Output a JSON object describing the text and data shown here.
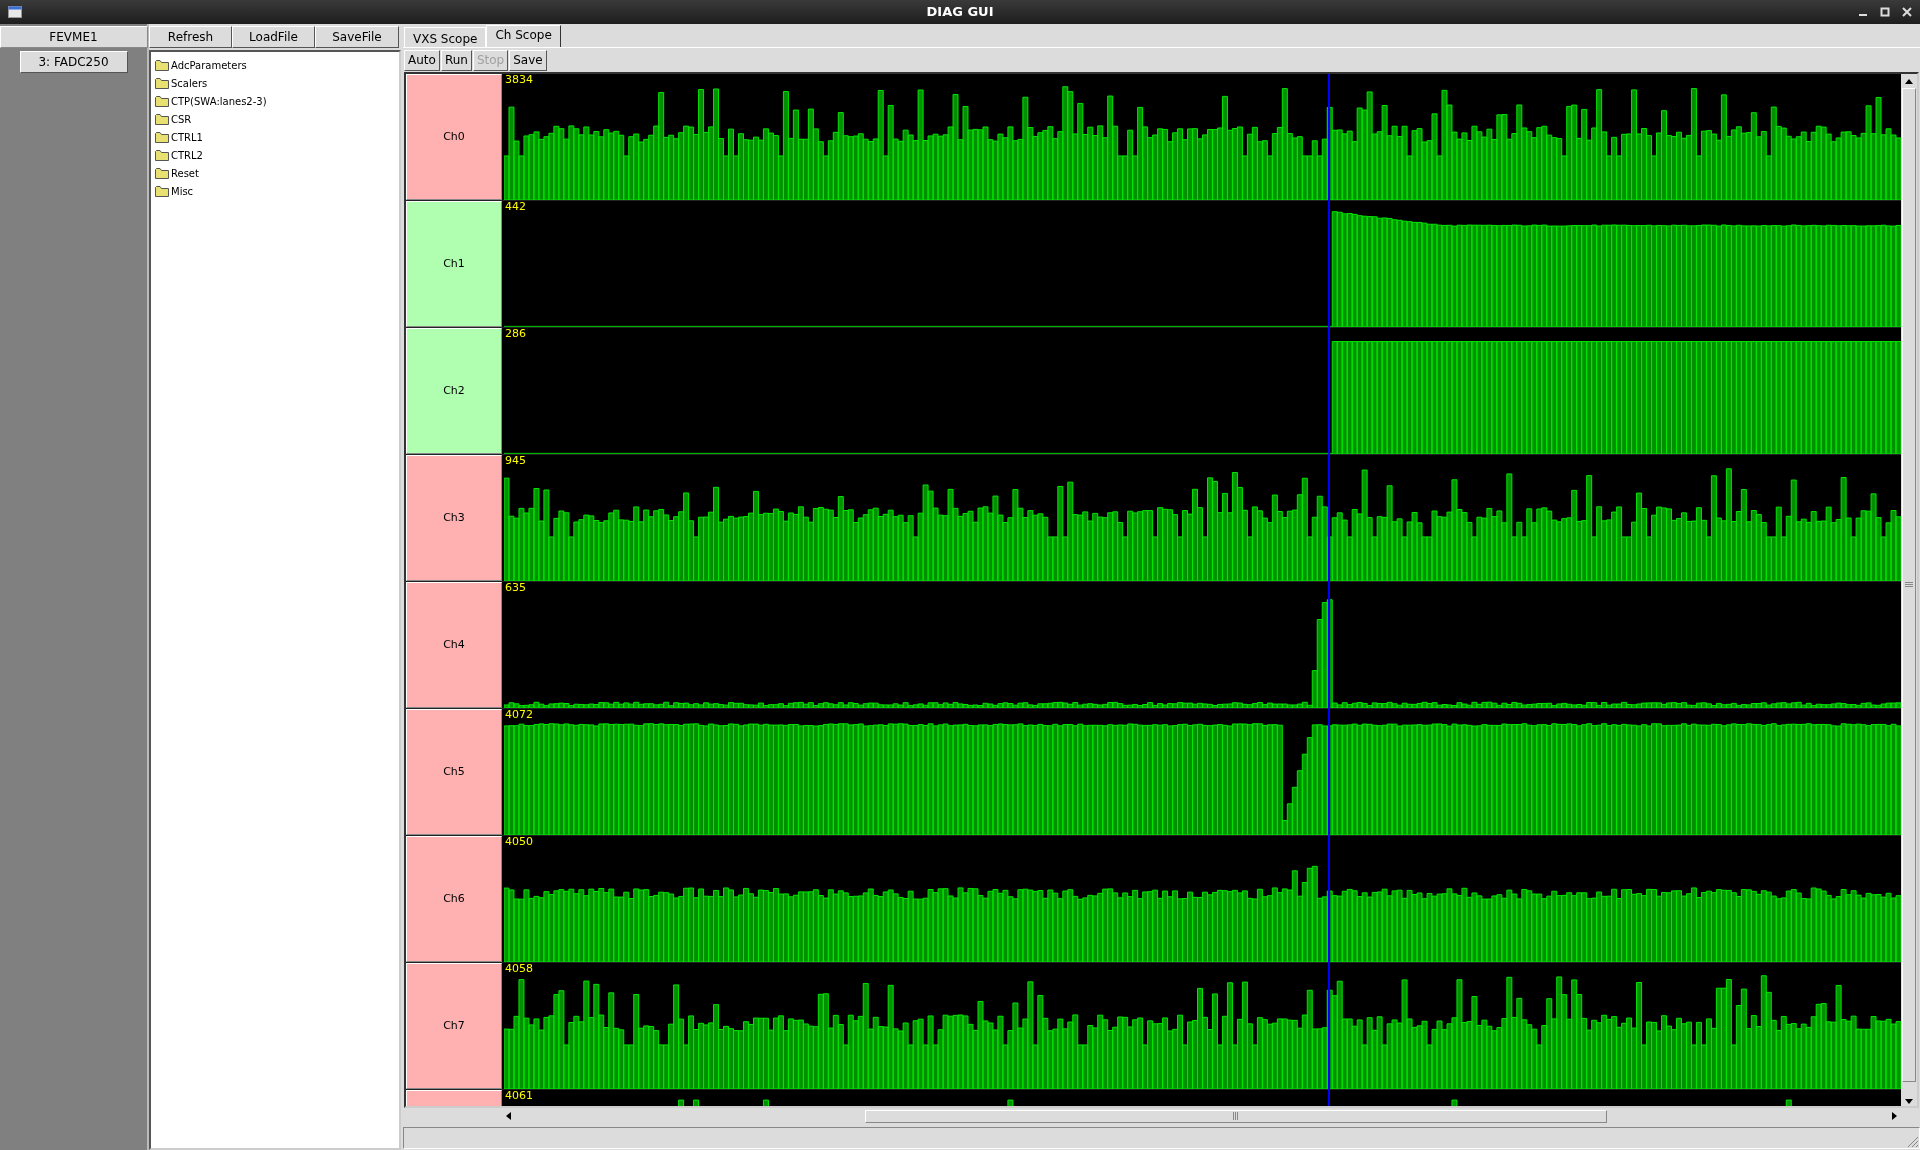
{
  "window": {
    "title": "DIAG GUI"
  },
  "crate": {
    "header": "FEVME1",
    "boards": [
      {
        "label": "3: FADC250"
      }
    ]
  },
  "file_buttons": [
    "Refresh",
    "LoadFile",
    "SaveFile"
  ],
  "tree": [
    {
      "label": "AdcParameters"
    },
    {
      "label": "Scalers"
    },
    {
      "label": "CTP(SWA:lanes2-3)"
    },
    {
      "label": "CSR"
    },
    {
      "label": "CTRL1"
    },
    {
      "label": "CTRL2"
    },
    {
      "label": "Reset"
    },
    {
      "label": "Misc"
    }
  ],
  "tabs": [
    {
      "label": "VXS Scope",
      "selected": false
    },
    {
      "label": "Ch Scope",
      "selected": true
    }
  ],
  "scope_buttons": [
    {
      "label": "Auto",
      "disabled": false
    },
    {
      "label": "Run",
      "disabled": false
    },
    {
      "label": "Stop",
      "disabled": true
    },
    {
      "label": "Save",
      "disabled": false
    }
  ],
  "channels": [
    {
      "label": "Ch0",
      "reading": "3834",
      "color": "#ffb0b0",
      "kind": "noise"
    },
    {
      "label": "Ch1",
      "reading": "442",
      "color": "#b0ffb0",
      "kind": "step"
    },
    {
      "label": "Ch2",
      "reading": "286",
      "color": "#b0ffb0",
      "kind": "step"
    },
    {
      "label": "Ch3",
      "reading": "945",
      "color": "#ffb0b0",
      "kind": "noise"
    },
    {
      "label": "Ch4",
      "reading": "635",
      "color": "#ffb0b0",
      "kind": "spike"
    },
    {
      "label": "Ch5",
      "reading": "4072",
      "color": "#ffb0b0",
      "kind": "saturated"
    },
    {
      "label": "Ch6",
      "reading": "4050",
      "color": "#ffb0b0",
      "kind": "steady"
    },
    {
      "label": "Ch7",
      "reading": "4058",
      "color": "#ffb0b0",
      "kind": "noise"
    },
    {
      "reading": "4061",
      "color": "#ffb0b0",
      "kind": "sparse"
    }
  ]
}
